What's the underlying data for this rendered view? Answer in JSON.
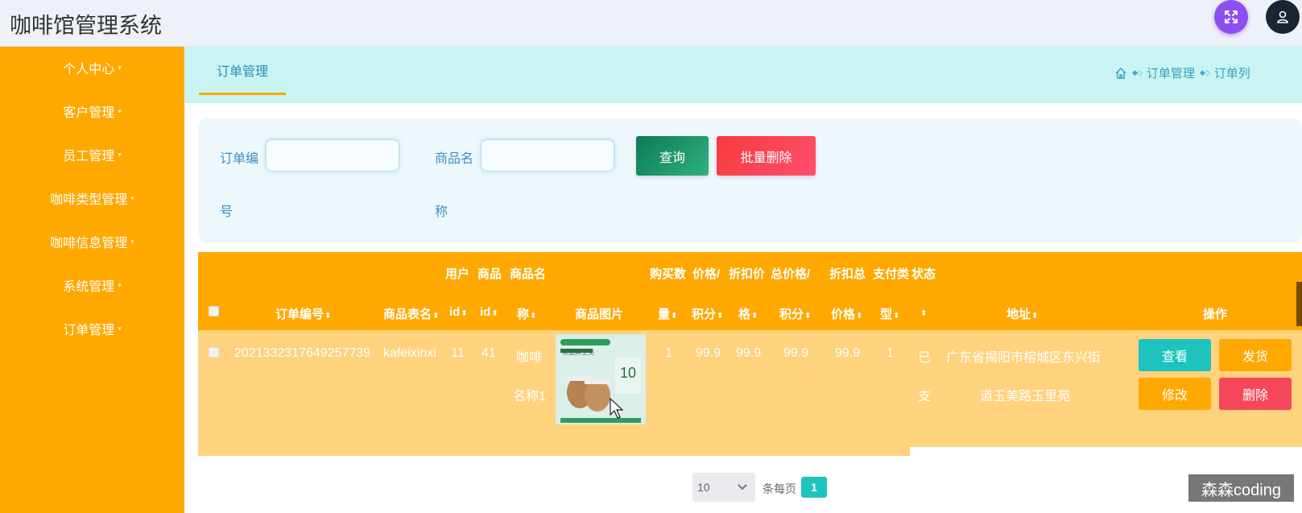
{
  "app": {
    "title": "咖啡馆管理系统"
  },
  "header": {
    "fullscreen_icon": "fullscreen-icon",
    "user_icon": "user-icon",
    "accent": "#8b4ff2"
  },
  "sidebar": {
    "items": [
      {
        "label": "个人中心"
      },
      {
        "label": "客户管理"
      },
      {
        "label": "员工管理"
      },
      {
        "label": "咖啡类型管理"
      },
      {
        "label": "咖啡信息管理"
      },
      {
        "label": "系统管理"
      },
      {
        "label": "订单管理"
      }
    ],
    "caret": "▾"
  },
  "tabs": [
    {
      "label": "订单管理"
    }
  ],
  "breadcrumb": {
    "items": [
      "订单管理",
      "订单列"
    ]
  },
  "search": {
    "order_no_label_1": "订单编",
    "order_no_label_2": "号",
    "product_name_label_1": "商品名",
    "product_name_label_2": "称",
    "order_no_value": "",
    "product_name_value": "",
    "query_label": "查询",
    "batch_delete_label": "批量删除"
  },
  "table": {
    "headers": {
      "order_no": "订单编号",
      "table_name": "商品表名",
      "user_id_1": "用户",
      "user_id_2": "id",
      "product_id_1": "商品",
      "product_id_2": "id",
      "product_name_1": "商品名",
      "product_name_2": "称",
      "image": "商品图片",
      "qty_1": "购买数",
      "qty_2": "量",
      "points_1": "价格/",
      "points_2": "积分",
      "discount_1": "折扣价",
      "discount_2": "格",
      "total_points_1": "总价格/",
      "total_points_2": "积分",
      "discount_total_1": "折扣总",
      "discount_total_2": "价格",
      "pay_type_1": "支付类",
      "pay_type_2": "型",
      "status_1": "状态",
      "address": "地址",
      "actions": "操作",
      "sort_icon": "⬍"
    },
    "rows": [
      {
        "order_no": "2021332317649257739",
        "table_name": "kafeixinxi",
        "user_id": "11",
        "product_id": "41",
        "product_name_1": "咖啡",
        "product_name_2": "名称1",
        "qty": "1",
        "points": "99.9",
        "discount": "99.9",
        "total_points": "99.9",
        "discount_total": "99.9",
        "pay_type": "1",
        "status_1": "已",
        "status_2": "支",
        "address_1": "广东省揭阳市榕城区东兴街",
        "address_2": "道玉美路玉里苑",
        "image_text_1": "新品鲜王尖",
        "image_text_2": "10",
        "actions": {
          "view": "查看",
          "ship": "发货",
          "edit": "修改",
          "delete": "删除"
        }
      }
    ]
  },
  "pagination": {
    "page_size": "10",
    "page_size_label": "条每页",
    "current_page": "1"
  },
  "watermark": "森森coding"
}
